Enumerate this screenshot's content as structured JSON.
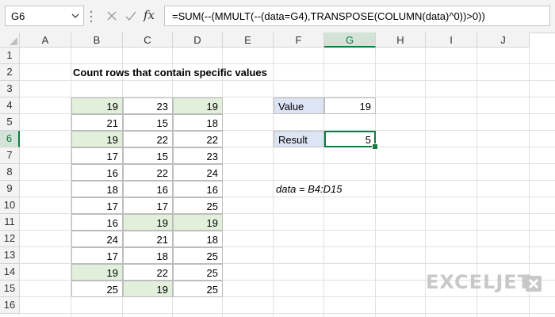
{
  "formula_bar": {
    "name_box": "G6",
    "fx_label": "fx",
    "formula": "=SUM(--(MMULT(--(data=G4),TRANSPOSE(COLUMN(data)^0))>0))"
  },
  "grid": {
    "columns": [
      "A",
      "B",
      "C",
      "D",
      "E",
      "F",
      "G",
      "H",
      "I",
      "J"
    ],
    "active_column": "G",
    "rows": [
      "1",
      "2",
      "3",
      "4",
      "5",
      "6",
      "7",
      "8",
      "9",
      "10",
      "11",
      "12",
      "13",
      "14",
      "15",
      "16"
    ],
    "active_row": "6"
  },
  "sheet": {
    "title": "Count rows that contain specific values",
    "data_rows": [
      [
        "19",
        "23",
        "19"
      ],
      [
        "21",
        "15",
        "18"
      ],
      [
        "19",
        "22",
        "22"
      ],
      [
        "17",
        "15",
        "23"
      ],
      [
        "16",
        "22",
        "24"
      ],
      [
        "18",
        "16",
        "16"
      ],
      [
        "17",
        "17",
        "25"
      ],
      [
        "16",
        "19",
        "19"
      ],
      [
        "24",
        "21",
        "18"
      ],
      [
        "17",
        "18",
        "25"
      ],
      [
        "19",
        "22",
        "25"
      ],
      [
        "25",
        "19",
        "25"
      ]
    ],
    "highlighted_cells": [
      "B4",
      "D4",
      "B6",
      "C11",
      "D11",
      "B14",
      "C15"
    ],
    "value_label": "Value",
    "value": "19",
    "result_label": "Result",
    "result": "5",
    "named_range_note": "data = B4:D15"
  },
  "watermark": {
    "text": "EXCELJET",
    "text_color": "#c8c8c8"
  },
  "colors": {
    "highlight_fill": "#e2efda",
    "label_fill": "#dde4f3",
    "excel_green": "#107c41"
  }
}
